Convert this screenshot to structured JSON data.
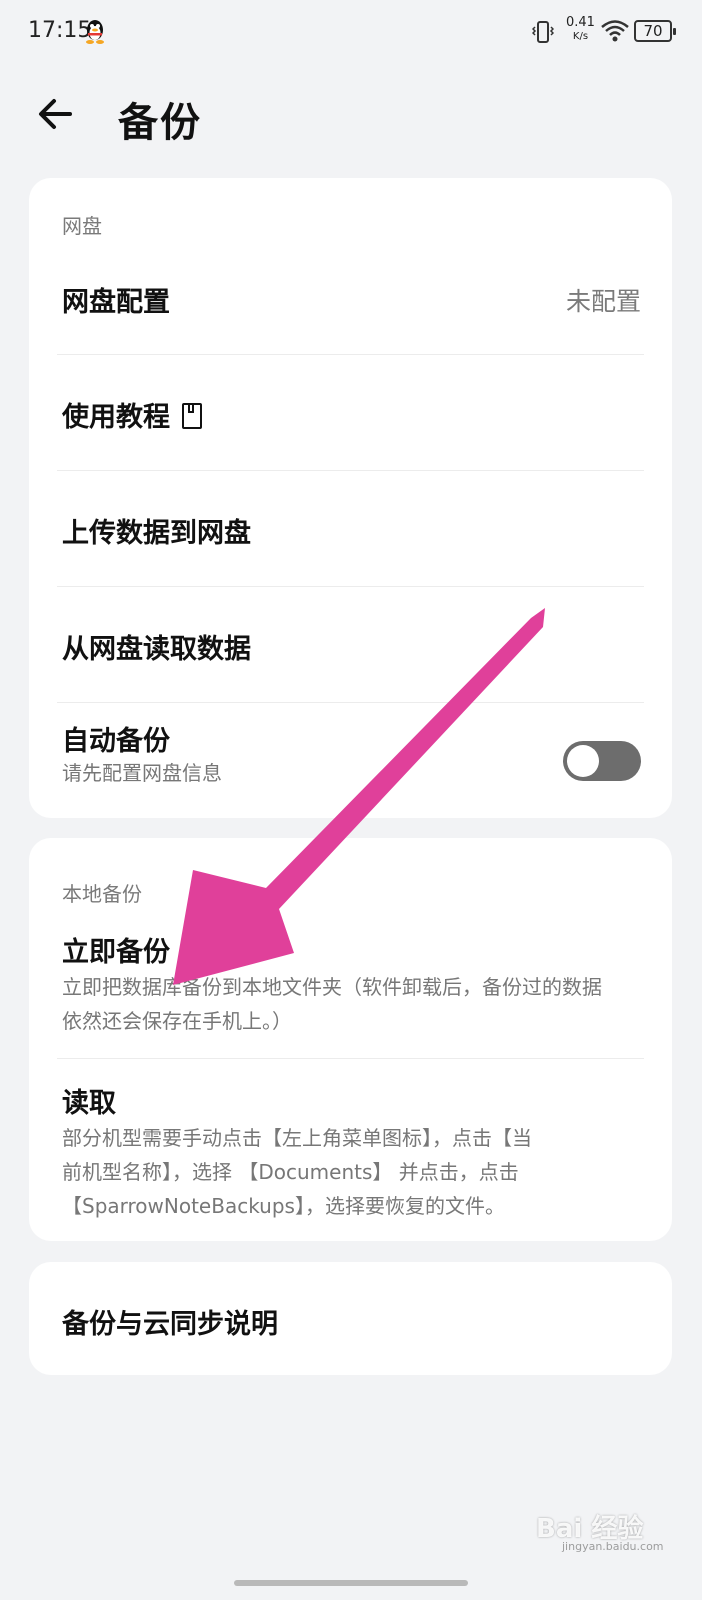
{
  "status_bar": {
    "time": "17:15",
    "net_speed_value": "0.41",
    "net_speed_unit": "K/s",
    "battery": "70"
  },
  "header": {
    "title": "备份"
  },
  "cloud_section": {
    "label": "网盘",
    "config": {
      "title": "网盘配置",
      "value": "未配置"
    },
    "tutorial": {
      "title": "使用教程"
    },
    "upload": {
      "title": "上传数据到网盘"
    },
    "download": {
      "title": "从网盘读取数据"
    },
    "auto_backup": {
      "title": "自动备份",
      "subtitle": "请先配置网盘信息",
      "enabled": false
    }
  },
  "local_section": {
    "label": "本地备份",
    "backup_now": {
      "title": "立即备份",
      "desc_line1": "立即把数据库备份到本地文件夹（软件卸载后，备份过的数据",
      "desc_line2": "依然还会保存在手机上。）"
    },
    "read": {
      "title": "读取",
      "desc_line1": "部分机型需要手动点击【左上角菜单图标】，点击【当",
      "desc_line2": "前机型名称】，选择 【Documents】 并点击，点击",
      "desc_line3": "【SparrowNoteBackups】，选择要恢复的文件。"
    }
  },
  "sync_card": {
    "title": "备份与云同步说明"
  },
  "watermark": {
    "brand": "Bai 经验",
    "url": "jingyan.baidu.com"
  },
  "colors": {
    "background": "#f2f3f5",
    "card": "#ffffff",
    "toggle_off": "#6d6d6d",
    "annotation_arrow": "#e0409a"
  }
}
